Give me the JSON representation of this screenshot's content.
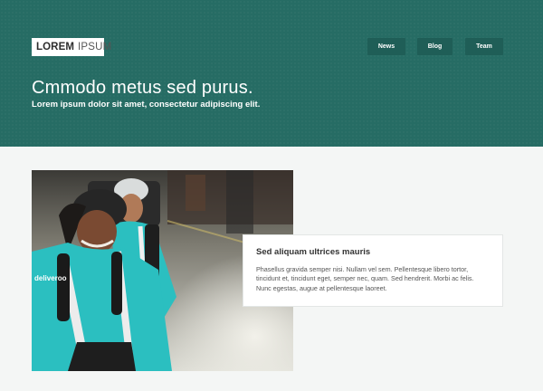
{
  "header": {
    "logo": {
      "bold": "LOREM",
      "light": "IPSUM"
    },
    "nav": [
      {
        "label": "News"
      },
      {
        "label": "Blog"
      },
      {
        "label": "Team"
      }
    ],
    "title": "Cmmodo metus sed purus.",
    "subtitle": "Lorem ipsum dolor sit amet, consectetur adipiscing elit."
  },
  "feature": {
    "photo_brand": "deliveroo",
    "card": {
      "title": "Sed aliquam ultrices mauris",
      "text": "Phasellus gravida semper nisi. Nullam vel sem. Pellentesque libero tortor, tincidunt et, tincidunt eget, semper nec, quam. Sed hendrerit. Morbi ac felis. Nunc egestas, augue at pellentesque laoreet."
    }
  },
  "colors": {
    "hero_bg": "#266c64",
    "nav_bg": "#1f5e57",
    "page_bg": "#f4f6f5",
    "jacket_teal": "#2bbfc0"
  }
}
